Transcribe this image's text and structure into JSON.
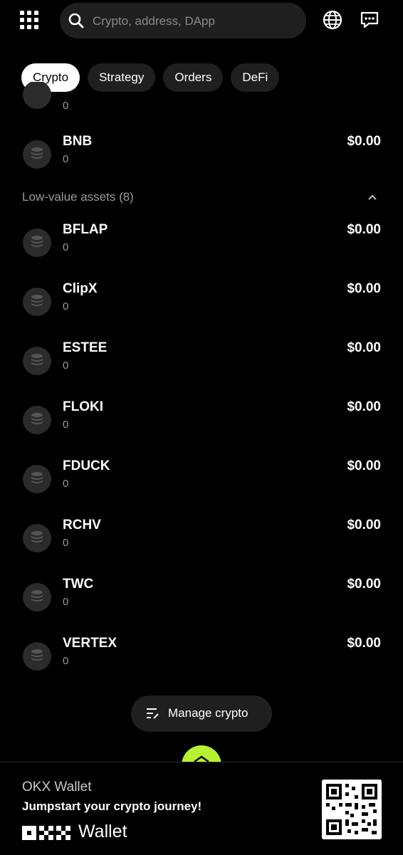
{
  "header": {
    "search_placeholder": "Crypto, address, DApp",
    "icons": [
      "apps-grid-icon",
      "search-icon",
      "globe-icon",
      "chat-icon"
    ]
  },
  "tabs": [
    {
      "label": "Crypto",
      "active": true
    },
    {
      "label": "Strategy",
      "active": false
    },
    {
      "label": "Orders",
      "active": false
    },
    {
      "label": "DeFi",
      "active": false
    }
  ],
  "partial_row": {
    "amount": "0"
  },
  "main_assets": [
    {
      "name": "BNB",
      "amount": "0",
      "value": "$0.00"
    }
  ],
  "low_value": {
    "title": "Low-value assets (8)",
    "assets": [
      {
        "name": "BFLAP",
        "amount": "0",
        "value": "$0.00"
      },
      {
        "name": "ClipX",
        "amount": "0",
        "value": "$0.00"
      },
      {
        "name": "ESTEE",
        "amount": "0",
        "value": "$0.00"
      },
      {
        "name": "FLOKI",
        "amount": "0",
        "value": "$0.00"
      },
      {
        "name": "FDUCK",
        "amount": "0",
        "value": "$0.00"
      },
      {
        "name": "RCHV",
        "amount": "0",
        "value": "$0.00"
      },
      {
        "name": "TWC",
        "amount": "0",
        "value": "$0.00"
      },
      {
        "name": "VERTEX",
        "amount": "0",
        "value": "$0.00"
      }
    ]
  },
  "manage_button": {
    "label": "Manage crypto"
  },
  "banner": {
    "title": "OKX Wallet",
    "subtitle": "Jumpstart your crypto journey!",
    "logo_text": "OKX",
    "logo_wallet": "Wallet"
  },
  "colors": {
    "background": "#000000",
    "surface": "#1f1f1f",
    "accent": "#b6f232",
    "muted_text": "#9a9a9a"
  }
}
